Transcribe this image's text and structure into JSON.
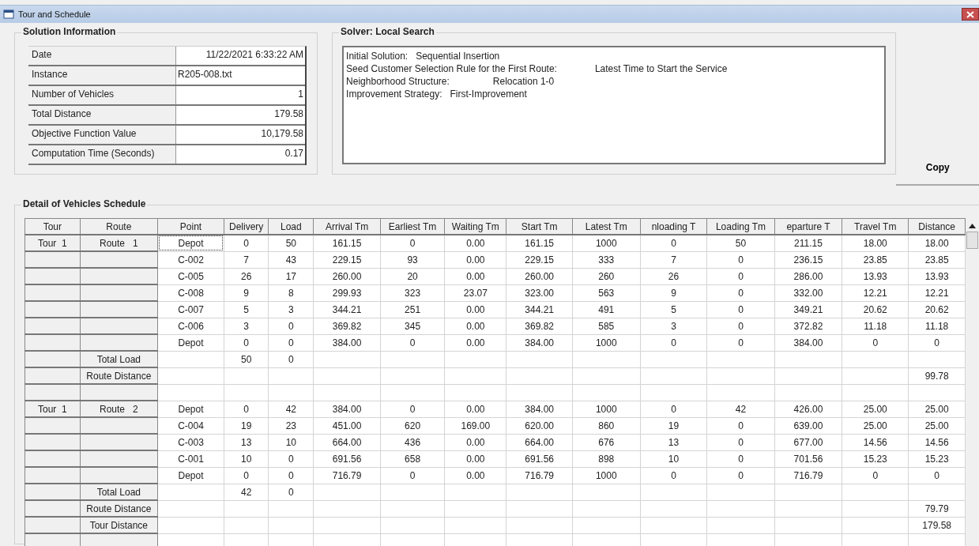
{
  "window": {
    "title": "Tour and Schedule"
  },
  "solution_information": {
    "title": "Solution Information",
    "rows": [
      {
        "label": "Date",
        "value": "11/22/2021 6:33:22 AM",
        "kind": "number"
      },
      {
        "label": "Instance",
        "value": "R205-008.txt",
        "kind": "text"
      },
      {
        "label": "Number of Vehicles",
        "value": "1",
        "kind": "number"
      },
      {
        "label": "Total Distance",
        "value": "179.58",
        "kind": "number"
      },
      {
        "label": "Objective Function Value",
        "value": "10,179.58",
        "kind": "number"
      },
      {
        "label": "Computation Time (Seconds)",
        "value": "0.17",
        "kind": "number"
      }
    ]
  },
  "solver": {
    "title": "Solver: Local Search",
    "lines": [
      {
        "label": "Initial Solution:",
        "value": "Sequential Insertion"
      },
      {
        "label": "Seed Customer Selection Rule for the First Route:",
        "value": "Latest Time to Start the Service"
      },
      {
        "label": "Neighborhood Structure:",
        "value": "Relocation 1-0"
      },
      {
        "label": "Improvement Strategy:",
        "value": "First-Improvement"
      }
    ]
  },
  "copy_button": "Copy",
  "schedule": {
    "title": "Detail of Vehicles Schedule",
    "columns": [
      "Tour",
      "Route",
      "Point",
      "Delivery",
      "Load",
      "Arrival Tm",
      "Earliest Tm",
      "Waiting Tm",
      "Start Tm",
      "Latest Tm",
      "nloading T",
      "Loading Tm",
      "eparture T",
      "Travel Tm",
      "Distance"
    ],
    "rows": [
      {
        "tour": "Tour  1",
        "route": "Route   1",
        "cells": [
          "Depot",
          "0",
          "50",
          "161.15",
          "0",
          "0.00",
          "161.15",
          "1000",
          "0",
          "50",
          "211.15",
          "18.00",
          "18.00"
        ]
      },
      {
        "cells": [
          "C-002",
          "7",
          "43",
          "229.15",
          "93",
          "0.00",
          "229.15",
          "333",
          "7",
          "0",
          "236.15",
          "23.85",
          "23.85"
        ]
      },
      {
        "cells": [
          "C-005",
          "26",
          "17",
          "260.00",
          "20",
          "0.00",
          "260.00",
          "260",
          "26",
          "0",
          "286.00",
          "13.93",
          "13.93"
        ]
      },
      {
        "cells": [
          "C-008",
          "9",
          "8",
          "299.93",
          "323",
          "23.07",
          "323.00",
          "563",
          "9",
          "0",
          "332.00",
          "12.21",
          "12.21"
        ]
      },
      {
        "cells": [
          "C-007",
          "5",
          "3",
          "344.21",
          "251",
          "0.00",
          "344.21",
          "491",
          "5",
          "0",
          "349.21",
          "20.62",
          "20.62"
        ]
      },
      {
        "cells": [
          "C-006",
          "3",
          "0",
          "369.82",
          "345",
          "0.00",
          "369.82",
          "585",
          "3",
          "0",
          "372.82",
          "11.18",
          "11.18"
        ]
      },
      {
        "cells": [
          "Depot",
          "0",
          "0",
          "384.00",
          "0",
          "0.00",
          "384.00",
          "1000",
          "0",
          "0",
          "384.00",
          "0",
          "0"
        ]
      },
      {
        "route": "Total Load",
        "delivery": "50",
        "load": "0"
      },
      {
        "route": "Route Distance",
        "distance": "99.78"
      },
      {},
      {
        "tour": "Tour  1",
        "route": "Route   2",
        "cells": [
          "Depot",
          "0",
          "42",
          "384.00",
          "0",
          "0.00",
          "384.00",
          "1000",
          "0",
          "42",
          "426.00",
          "25.00",
          "25.00"
        ]
      },
      {
        "cells": [
          "C-004",
          "19",
          "23",
          "451.00",
          "620",
          "169.00",
          "620.00",
          "860",
          "19",
          "0",
          "639.00",
          "25.00",
          "25.00"
        ]
      },
      {
        "cells": [
          "C-003",
          "13",
          "10",
          "664.00",
          "436",
          "0.00",
          "664.00",
          "676",
          "13",
          "0",
          "677.00",
          "14.56",
          "14.56"
        ]
      },
      {
        "cells": [
          "C-001",
          "10",
          "0",
          "691.56",
          "658",
          "0.00",
          "691.56",
          "898",
          "10",
          "0",
          "701.56",
          "15.23",
          "15.23"
        ]
      },
      {
        "cells": [
          "Depot",
          "0",
          "0",
          "716.79",
          "0",
          "0.00",
          "716.79",
          "1000",
          "0",
          "0",
          "716.79",
          "0",
          "0"
        ]
      },
      {
        "route": "Total Load",
        "delivery": "42",
        "load": "0"
      },
      {
        "route": "Route Distance",
        "distance": "79.79"
      },
      {
        "route": "Tour Distance",
        "distance": "179.58"
      },
      {}
    ]
  }
}
